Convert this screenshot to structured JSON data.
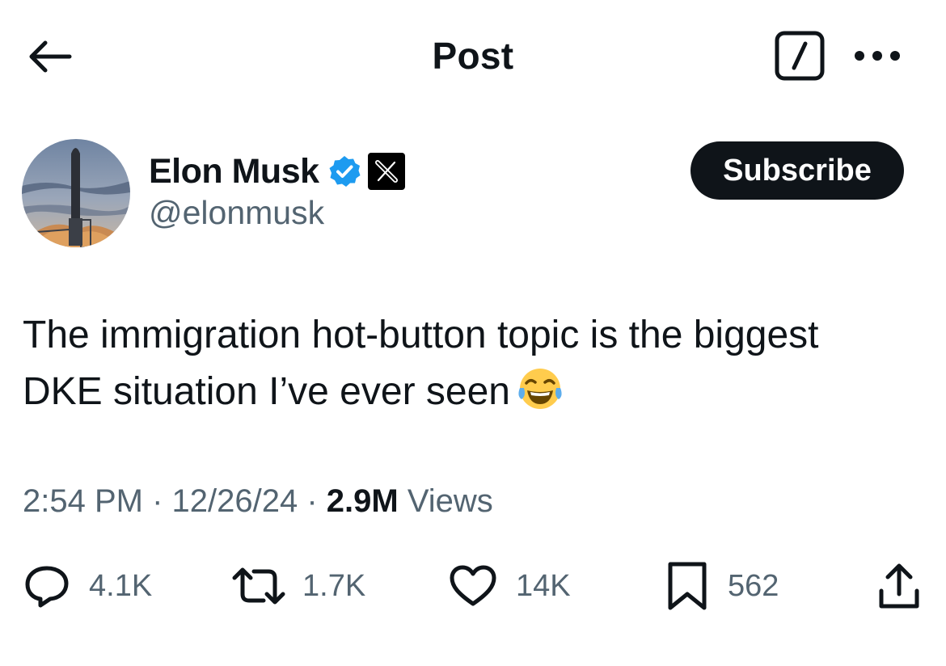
{
  "header": {
    "title": "Post",
    "icons": {
      "back": "back-arrow-icon",
      "grok": "grok-icon",
      "more": "more-icon"
    }
  },
  "author": {
    "name": "Elon Musk",
    "handle": "@elonmusk",
    "verified_icon": "verified-badge-icon",
    "affiliation_icon": "x-logo-icon",
    "subscribe_label": "Subscribe",
    "verified_color": "#1d9bf0"
  },
  "post": {
    "text_line1": "The immigration hot-button topic is the biggest",
    "text_line2": "DKE situation I’ve ever seen",
    "emoji_icon": "tears-of-joy-emoji-icon"
  },
  "meta": {
    "time": "2:54 PM",
    "sep1": " · ",
    "date": "12/26/24",
    "sep2": " · ",
    "views_count": "2.9M",
    "views_label": " Views"
  },
  "actions": {
    "reply": {
      "icon": "reply-icon",
      "count": "4.1K"
    },
    "repost": {
      "icon": "repost-icon",
      "count": "1.7K"
    },
    "like": {
      "icon": "like-icon",
      "count": "14K"
    },
    "bookmark": {
      "icon": "bookmark-icon",
      "count": "562"
    },
    "share": {
      "icon": "share-icon"
    }
  },
  "colors": {
    "text": "#0f1419",
    "secondary": "#536471",
    "background": "#ffffff"
  }
}
